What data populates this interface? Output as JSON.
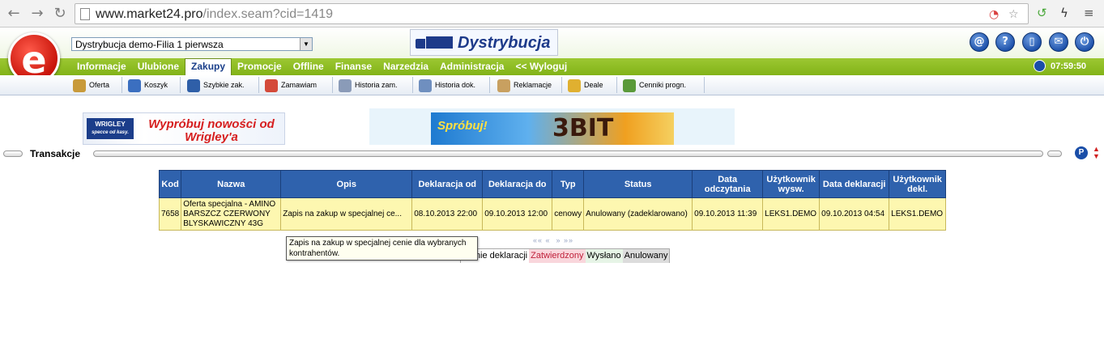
{
  "browser": {
    "url_host": "www.market24.pro",
    "url_path": "/index.seam?cid=1419"
  },
  "header": {
    "branch_select_value": "Dystrybucja demo-Filia 1 pierwsza",
    "logo_letter": "e",
    "module_logo_text": "Dystrybucja",
    "session_timer": "07:59:50",
    "icons": [
      "at-icon",
      "help-icon",
      "document-icon",
      "mail-icon",
      "power-icon"
    ]
  },
  "menu": {
    "items": [
      "Informacje",
      "Ulubione",
      "Zakupy",
      "Promocje",
      "Offline",
      "Finanse",
      "Narzedzia",
      "Administracja",
      "<< Wyloguj"
    ],
    "active": "Zakupy"
  },
  "toolbar": {
    "items": [
      "Oferta",
      "Koszyk",
      "Szybkie zak.",
      "Zamawiam",
      "Historia zam.",
      "Historia dok.",
      "Reklamacje",
      "Deale",
      "Cenniki progn."
    ]
  },
  "banners": {
    "b1_brand": "WRIGLEY",
    "b1_brand_sub": "specce od kasy.",
    "b1_text": "Wypróbuj nowości od Wrigley'a",
    "b2_text": "Spróbuj!",
    "b2_brand": "3BIT"
  },
  "section": {
    "title": "Transakcje",
    "badge": "P"
  },
  "table": {
    "headers": [
      "Kod",
      "Nazwa",
      "Opis",
      "Deklaracja od",
      "Deklaracja do",
      "Typ",
      "Status",
      "Data odczytania",
      "Użytkownik wysw.",
      "Data deklaracji",
      "Użytkownik dekl."
    ],
    "rows": [
      {
        "kod": "7658",
        "nazwa": "Oferta specjalna - AMINO BARSZCZ CZERWONY BLYSKAWICZNY 43G",
        "opis": "Zapis na zakup w specjalnej ce...",
        "deklaracja_od": "08.10.2013 22:00",
        "deklaracja_do": "09.10.2013 12:00",
        "typ": "cenowy",
        "status": "Anulowany (zadeklarowano)",
        "data_odczytania": "09.10.2013 11:39",
        "uzytkownik_wysw": "LEKS1.DEMO",
        "data_deklaracji": "09.10.2013 04:54",
        "uzytkownik_dekl": "LEKS1.DEMO"
      }
    ]
  },
  "pager": {
    "prev": "«« «",
    "next": "» »»"
  },
  "legend": {
    "items": [
      "eranie deklaracji",
      "Zatwierdzony",
      "Wysłano",
      "Anulowany"
    ],
    "colors": [
      "#ffffff",
      "#f9d6dc",
      "#e6f4e6",
      "#dcdcdc"
    ],
    "text_colors": [
      "#000000",
      "#c0203a",
      "#000000",
      "#000000"
    ]
  },
  "tooltip": {
    "text": "Zapis na zakup w specjalnej cenie dla wybranych kontrahentów."
  }
}
